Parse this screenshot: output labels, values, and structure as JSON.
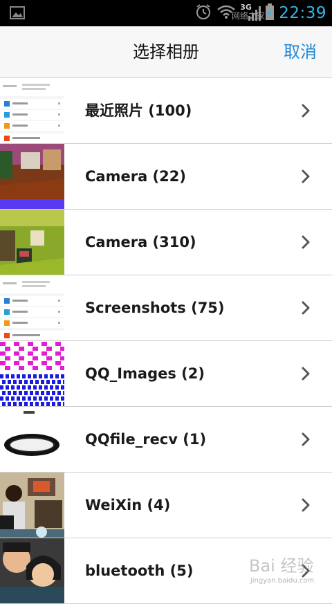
{
  "status_bar": {
    "time": "22:39",
    "network": "3G",
    "watermark": "网络之家"
  },
  "header": {
    "title": "选择相册",
    "cancel_label": "取消"
  },
  "albums": [
    {
      "label": "最近照片 (100)",
      "thumb": "screenshot"
    },
    {
      "label": "Camera (22)",
      "thumb": "room"
    },
    {
      "label": "Camera (310)",
      "thumb": "green"
    },
    {
      "label": "Screenshots (75)",
      "thumb": "screenshot"
    },
    {
      "label": "QQ_Images (2)",
      "thumb": "checker"
    },
    {
      "label": "QQfile_recv (1)",
      "thumb": "filter"
    },
    {
      "label": "WeiXin (4)",
      "thumb": "person"
    },
    {
      "label": "bluetooth (5)",
      "thumb": "faces"
    }
  ],
  "footer_watermark": {
    "text": "Bai 经验",
    "url": "jingyan.baidu.com"
  },
  "colors": {
    "accent": "#1e88d8",
    "status_time": "#33b5e5",
    "divider": "#cfcfcf"
  }
}
